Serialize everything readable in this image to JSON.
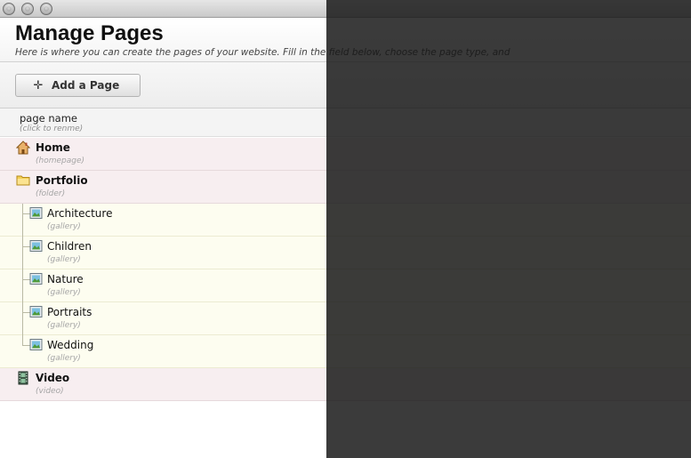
{
  "header": {
    "title": "Manage Pages",
    "description": "Here is where you can create the pages of your website. Fill in the field below, choose the page type, and"
  },
  "toolbar": {
    "add_page_label": "Add a Page"
  },
  "table": {
    "column_title": "page name",
    "column_hint": "(click to renme)"
  },
  "pages": [
    {
      "name": "Home",
      "type": "(homepage)",
      "icon": "home-icon"
    },
    {
      "name": "Portfolio",
      "type": "(folder)",
      "icon": "folder-icon"
    },
    {
      "name": "Architecture",
      "type": "(gallery)",
      "icon": "gallery-icon"
    },
    {
      "name": "Children",
      "type": "(gallery)",
      "icon": "gallery-icon"
    },
    {
      "name": "Nature",
      "type": "(gallery)",
      "icon": "gallery-icon"
    },
    {
      "name": "Portraits",
      "type": "(gallery)",
      "icon": "gallery-icon"
    },
    {
      "name": "Wedding",
      "type": "(gallery)",
      "icon": "gallery-icon"
    },
    {
      "name": "Video",
      "type": "(video)",
      "icon": "video-icon"
    }
  ],
  "colors": {
    "top_row_bg": "#f7eef0",
    "child_row_bg": "#fdfdf0",
    "overlay": "#161616"
  }
}
